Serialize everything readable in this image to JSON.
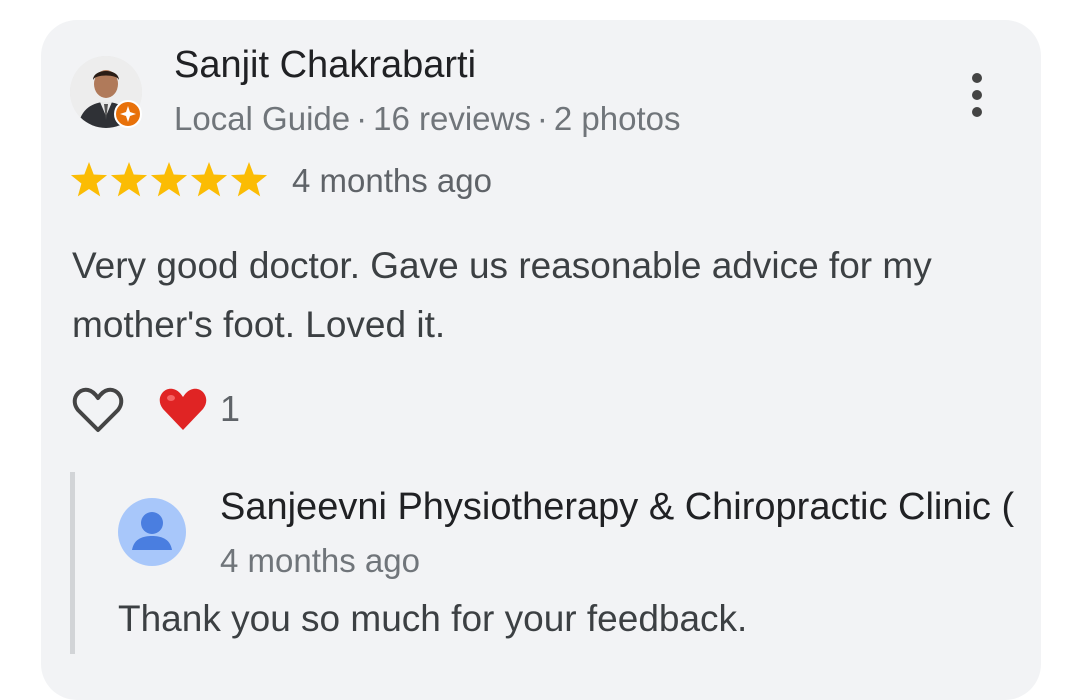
{
  "review": {
    "author": "Sanjit Chakrabarti",
    "meta": {
      "level": "Local Guide",
      "reviews": "16 reviews",
      "photos": "2 photos",
      "separator": "·"
    },
    "rating": 5,
    "rating_max": 5,
    "time": "4 months ago",
    "text": "Very good doctor. Gave us reasonable advice for my mother's foot. Loved it.",
    "reaction_count": "1"
  },
  "owner_reply": {
    "name": "Sanjeevni Physiotherapy & Chiropractic Clinic (",
    "time": "4 months ago",
    "text": "Thank you so much for your feedback."
  },
  "icons": {
    "like": "heart-outline-icon",
    "reaction": "red-heart-icon",
    "more": "more-vert-icon",
    "local_guide_badge": "local-guide-badge-icon",
    "star": "star-icon"
  },
  "colors": {
    "card_bg": "#f2f3f5",
    "star": "#fbbc04",
    "badge": "#e8710a",
    "heart_red": "#e02424",
    "owner_avatar_bg": "#a8c7fa",
    "owner_avatar_fg": "#4a7ee0"
  }
}
